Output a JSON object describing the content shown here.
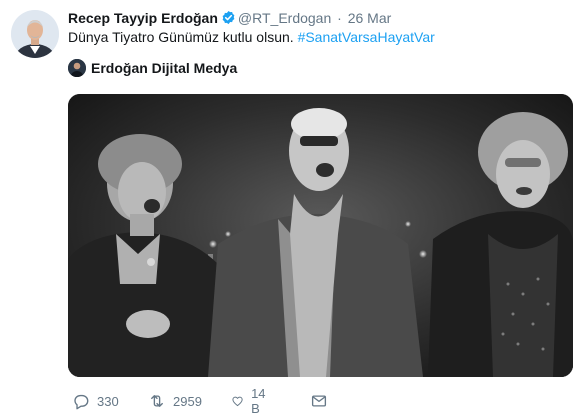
{
  "tweet": {
    "author_name": "Recep Tayyip Erdoğan",
    "handle": "@RT_Erdogan",
    "separator": "·",
    "date": "26 Mar",
    "text": "Dünya Tiyatro Günümüz kutlu olsun.",
    "hashtag": "#SanatVarsaHayatVar",
    "verified_icon": "verified-badge-icon"
  },
  "source": {
    "name": "Erdoğan Dijital Medya"
  },
  "media": {
    "type": "video-still",
    "description_icon": "photo-three-singers"
  },
  "actions": {
    "reply_count": "330",
    "retweet_count": "2959",
    "like_count": "14 B",
    "reply_icon": "reply-icon",
    "retweet_icon": "retweet-icon",
    "like_icon": "heart-icon",
    "dm_icon": "envelope-icon"
  },
  "colors": {
    "link": "#1da1f2",
    "muted": "#657786",
    "verified": "#1da1f2"
  }
}
